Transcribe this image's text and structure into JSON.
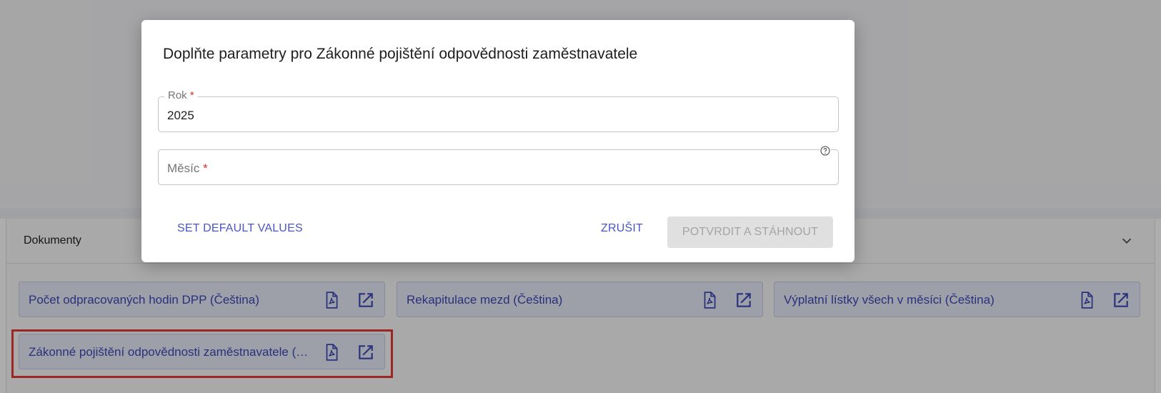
{
  "dialog": {
    "title": "Doplňte parametry pro Zákonné pojištění odpovědnosti zaměstnavatele",
    "fields": {
      "rok": {
        "label": "Rok",
        "required_mark": "*",
        "value": "2025"
      },
      "mesic": {
        "label": "Měsíc",
        "required_mark": "*",
        "value": ""
      }
    },
    "buttons": {
      "set_default": "SET DEFAULT VALUES",
      "cancel": "ZRUŠIT",
      "confirm": "POTVRDIT A STÁHNOUT"
    }
  },
  "documents": {
    "title": "Dokumenty",
    "items": [
      {
        "label": "Počet odpracovaných hodin DPP (Čeština)"
      },
      {
        "label": "Rekapitulace mezd (Čeština)"
      },
      {
        "label": "Výplatní lístky všech v měsíci (Čeština)"
      },
      {
        "label": "Zákonné pojištění odpovědnosti zaměstnavatele (Čeština)"
      }
    ]
  },
  "colors": {
    "accent": "#4a55c9",
    "chip_bg": "#e8eaf9",
    "required": "#d32f2f",
    "highlight": "#e53935"
  },
  "icons": {
    "pdf": "file-pdf-icon",
    "open": "open-in-new-icon",
    "help": "help-circle-icon",
    "chevron": "chevron-down-icon"
  }
}
